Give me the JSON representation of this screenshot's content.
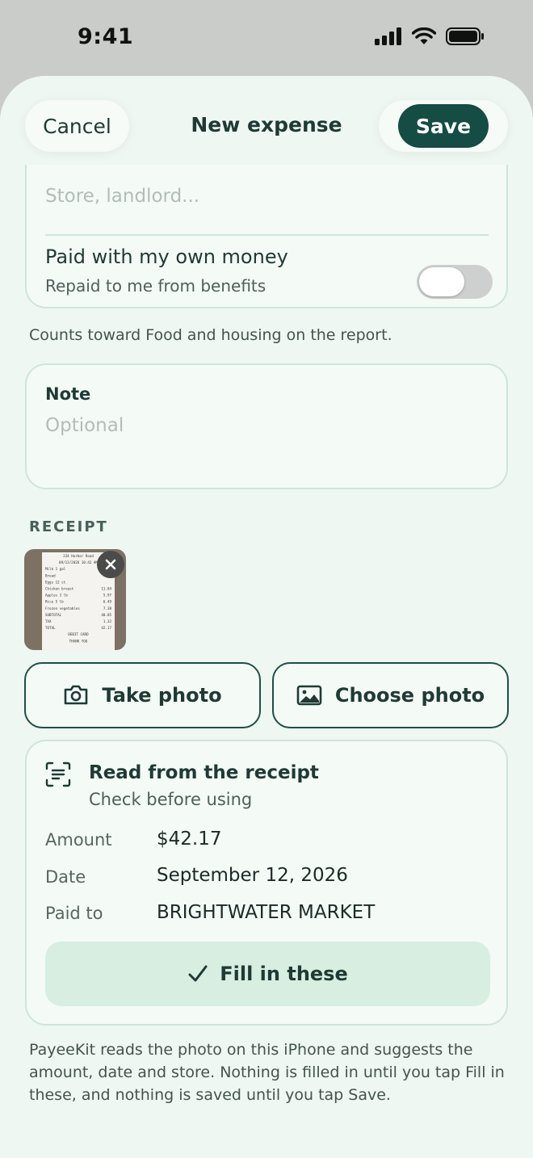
{
  "status_bar": {
    "time": "9:41"
  },
  "header": {
    "cancel_label": "Cancel",
    "title": "New expense",
    "save_label": "Save"
  },
  "payee": {
    "placeholder": "Store, landlord...",
    "own_money_label": "Paid with my own money",
    "own_money_sub": "Repaid to me from benefits",
    "own_money_on": false
  },
  "counts_note": "Counts toward Food and housing on the report.",
  "note": {
    "label": "Note",
    "placeholder": "Optional"
  },
  "receipt": {
    "section_label": "RECEIPT",
    "take_photo_label": "Take photo",
    "choose_photo_label": "Choose photo"
  },
  "receipt_image": {
    "lines": [
      "234 Harbor Road",
      "09/12/2026 10:42 AM",
      "Milk 1 gal",
      "Bread",
      "Eggs 12 ct",
      "Chicken breast",
      "Apples 3 lb",
      "Rice 5 lb",
      "Frozen vegetables",
      "SUBTOTAL",
      "TAX",
      "TOTAL",
      "DEBIT CARD",
      "THANK YOU"
    ],
    "prices": [
      "",
      "",
      "",
      "",
      "",
      "11.84",
      "5.97",
      "6.49",
      "7.38",
      "40.85",
      "1.32",
      "42.17",
      "",
      ""
    ]
  },
  "read": {
    "title": "Read from the receipt",
    "subtitle": "Check before using",
    "fields": [
      {
        "label": "Amount",
        "value": "$42.17"
      },
      {
        "label": "Date",
        "value": "September 12, 2026"
      },
      {
        "label": "Paid to",
        "value": "BRIGHTWATER MARKET"
      }
    ],
    "fill_label": "Fill in these"
  },
  "footer_note": "PayeeKit reads the photo on this iPhone and suggests the amount, date and store. Nothing is filled in until you tap Fill in these, and nothing is saved until you tap Save.",
  "colors": {
    "accent": "#154c44",
    "sheet_bg": "#eef7f1",
    "card_border": "#cfe5d9",
    "fill_bg": "#d7eee0"
  }
}
